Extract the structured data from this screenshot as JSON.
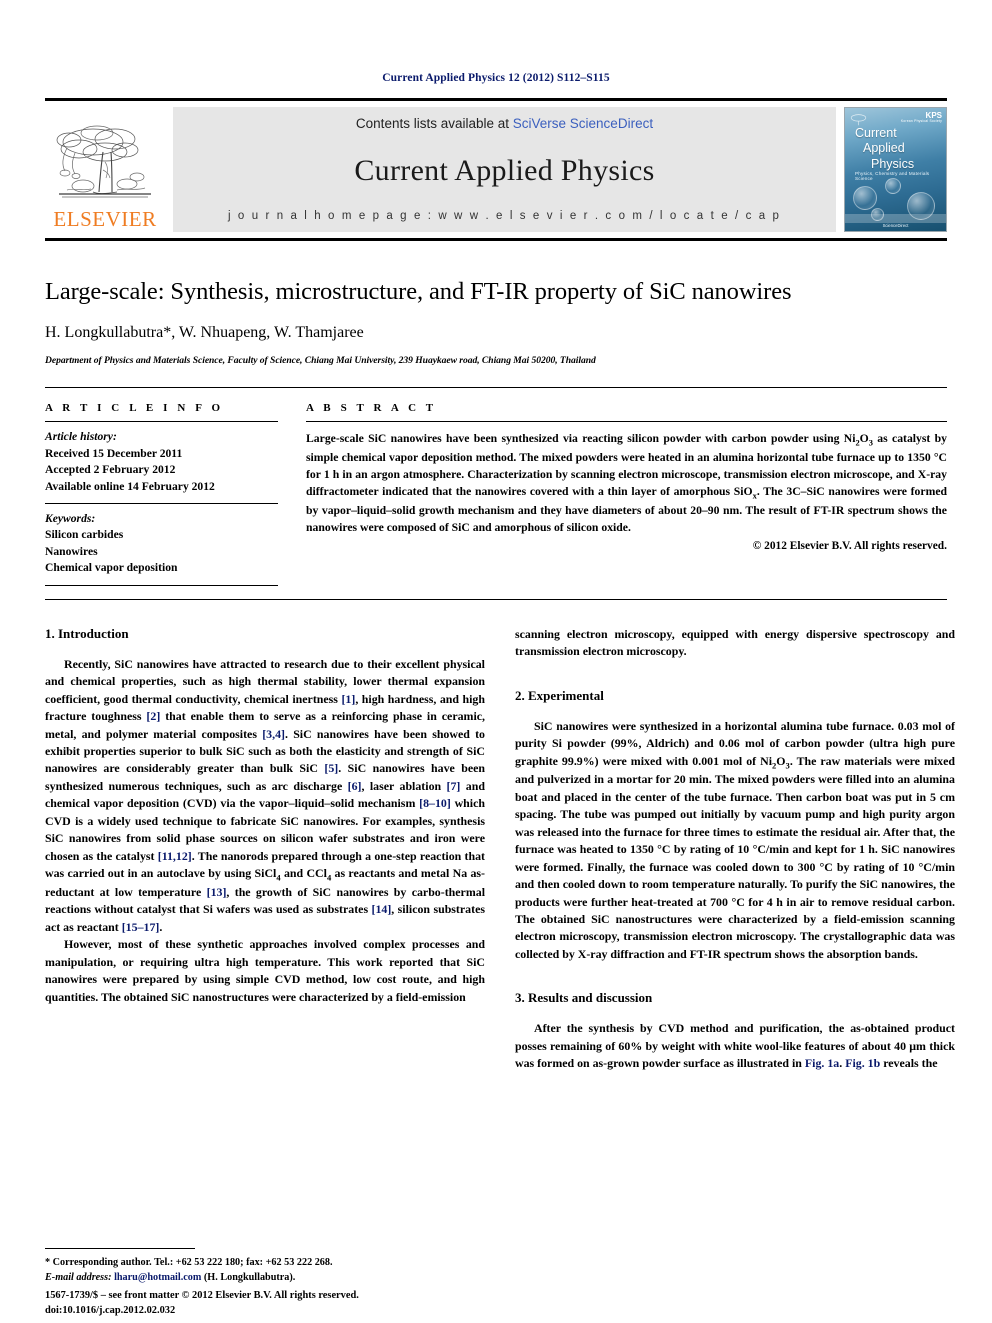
{
  "running_head": "Current Applied Physics 12 (2012) S112–S115",
  "masthead": {
    "publisher_wordmark": "ELSEVIER",
    "contents_prefix": "Contents lists available at ",
    "contents_link": "SciVerse ScienceDirect",
    "journal_title": "Current Applied Physics",
    "homepage_label": "j o u r n a l   h o m e p a g e :   w w w . e l s e v i e r . c o m / l o c a t e / c a p",
    "cover": {
      "line1": "Current",
      "line2": "Applied",
      "line3": "Physics",
      "subtitle": "Physics, Chemistry and Materials Science",
      "badge": "KPS",
      "badge_sub": "Korean Physical Society",
      "footer": "ScienceDirect"
    }
  },
  "article": {
    "title": "Large-scale: Synthesis, microstructure, and FT-IR property of SiC nanowires",
    "authors": "H. Longkullabutra*, W. Nhuapeng, W. Thamjaree",
    "affiliation": "Department of Physics and Materials Science, Faculty of Science, Chiang Mai University, 239 Huaykaew road, Chiang Mai 50200, Thailand"
  },
  "article_info": {
    "heading": "A R T I C L E   I N F O",
    "history_label": "Article history:",
    "history": [
      "Received 15 December 2011",
      "Accepted 2 February 2012",
      "Available online 14 February 2012"
    ],
    "keywords_label": "Keywords:",
    "keywords": [
      "Silicon carbides",
      "Nanowires",
      "Chemical vapor deposition"
    ]
  },
  "abstract": {
    "heading": "A B S T R A C T",
    "text_part1": "Large-scale SiC nanowires have been synthesized via reacting silicon powder with carbon powder using Ni",
    "text_part2": "O",
    "text_part3": " as catalyst by simple chemical vapor deposition method. The mixed powders were heated in an alumina horizontal tube furnace up to 1350 °C for 1 h in an argon atmosphere. Characterization by scanning electron microscope, transmission electron microscope, and X-ray diffractometer indicated that the nanowires covered with a thin layer of amorphous SiO",
    "text_part4": ". The 3C–SiC nanowires were formed by vapor–liquid–solid growth mechanism and they have diameters of about 20–90 nm. The result of FT-IR spectrum shows the nanowires were composed of SiC and amorphous of silicon oxide.",
    "sub_2": "2",
    "sub_3": "3",
    "sub_x": "x",
    "copyright": "© 2012 Elsevier B.V. All rights reserved."
  },
  "sections": {
    "introduction": {
      "heading": "1.  Introduction",
      "p1_a": "Recently, SiC nanowires have attracted to research due to their excellent physical and chemical properties, such as high thermal stability, lower thermal expansion coefficient, good thermal conductivity, chemical inertness ",
      "ref1": "[1]",
      "p1_b": ", high hardness, and high fracture toughness ",
      "ref2": "[2]",
      "p1_c": " that enable them to serve as a reinforcing phase in ceramic, metal, and polymer material composites ",
      "ref34": "[3,4]",
      "p1_d": ". SiC nanowires have been showed to exhibit properties superior to bulk SiC such as both the elasticity and strength of SiC nanowires are considerably greater than bulk SiC ",
      "ref5": "[5]",
      "p1_e": ". SiC nanowires have been synthesized numerous techniques, such as arc discharge ",
      "ref6": "[6]",
      "p1_f": ", laser ablation ",
      "ref7": "[7]",
      "p1_g": " and chemical vapor deposition (CVD) via the vapor–liquid–solid mechanism ",
      "ref810": "[8–10]",
      "p1_h": " which CVD is a widely used technique to fabricate SiC nanowires. For examples, synthesis SiC nanowires from solid phase sources on silicon wafer substrates and iron were chosen as the catalyst ",
      "ref1112": "[11,12]",
      "p1_i": ". The nanorods prepared through a one-step reaction that was carried out in an autoclave by using SiCl",
      "sub_4a": "4",
      "p1_j": " and CCl",
      "sub_4b": "4",
      "p1_k": " as reactants and metal Na as-reductant at low temperature ",
      "ref13": "[13]",
      "p1_l": ", the growth of SiC nanowires by carbo-thermal reactions without catalyst that Si wafers was used as substrates ",
      "ref14": "[14]",
      "p1_m": ", silicon substrates act as reactant ",
      "ref1517": "[15–17]",
      "p1_n": ".",
      "p2": "However, most of these synthetic approaches involved complex processes and manipulation, or requiring ultra high temperature. This work reported that SiC nanowires were prepared by using simple CVD method, low cost route, and high quantities. The obtained SiC nanostructures were characterized by a field-emission",
      "p2_cont": "scanning electron microscopy, equipped with energy dispersive spectroscopy and transmission electron microscopy."
    },
    "experimental": {
      "heading": "2.  Experimental",
      "p1_a": "SiC nanowires were synthesized in a horizontal alumina tube furnace. 0.03 mol of purity Si powder (99%, Aldrich) and 0.06 mol of carbon powder (ultra high pure graphite 99.9%) were mixed with 0.001 mol of Ni",
      "sub_2": "2",
      "p1_b": "O",
      "sub_3": "3",
      "p1_c": ". The raw materials were mixed and pulverized in a mortar for 20 min. The mixed powders were filled into an alumina boat and placed in the center of the tube furnace. Then carbon boat was put in 5 cm spacing. The tube was pumped out initially by vacuum pump and high purity argon was released into the furnace for three times to estimate the residual air. After that, the furnace was heated to 1350 °C by rating of 10 °C/min and kept for 1 h. SiC nanowires were formed. Finally, the furnace was cooled down to 300 °C by rating of 10 °C/min and then cooled down to room temperature naturally. To purify the SiC nanowires, the products were further heat-treated at 700 °C for 4 h in air to remove residual carbon. The obtained SiC nanostructures were characterized by a field-emission scanning electron microscopy, transmission electron microscopy. The crystallographic data was collected by X-ray diffraction and FT-IR spectrum shows the absorption bands."
    },
    "results": {
      "heading": "3.  Results and discussion",
      "p1_a": "After the synthesis by CVD method and purification, the as-obtained product posses remaining of 60% by weight with white wool-like features of about 40 μm thick was formed on as-grown powder surface as illustrated in ",
      "fig1a": "Fig. 1a",
      "p1_b": ". ",
      "fig1b": "Fig. 1b",
      "p1_c": " reveals the"
    }
  },
  "footnote": {
    "corresponding": "* Corresponding author. Tel.: +62 53 222 180; fax: +62 53 222 268.",
    "email_label": "E-mail address:",
    "email": "lharu@hotmail.com",
    "email_suffix": "(H. Longkullabutra)."
  },
  "imprint": {
    "line1": "1567-1739/$ – see front matter © 2012 Elsevier B.V. All rights reserved.",
    "doi": "doi:10.1016/j.cap.2012.02.032"
  },
  "colors": {
    "link_blue": "#0a1a6b",
    "sciencedirect_blue": "#3b5fbe",
    "elsevier_orange": "#ef7c22",
    "band_gray": "#e6e6e6"
  }
}
